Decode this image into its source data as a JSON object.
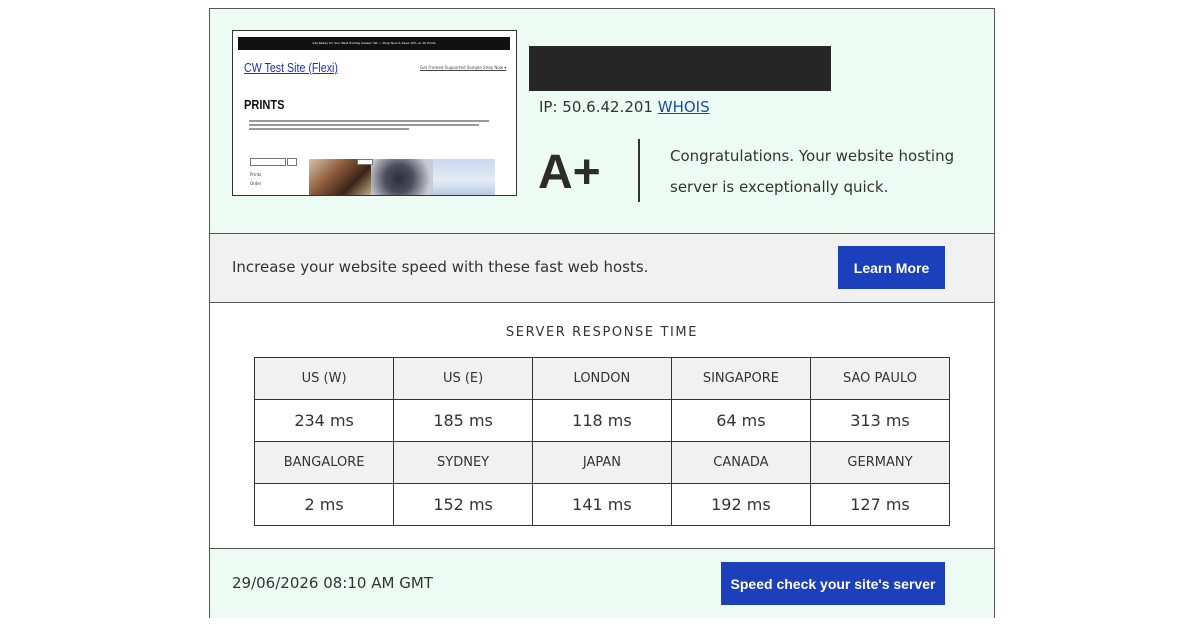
{
  "thumbnail": {
    "topbar_text": "Get Ready for Your Best Holiday Season Yet — Shop Now & Save 10% on All Prints",
    "site_title": "CW Test Site (Flexi)",
    "nav_text": "Get Framed  Supported  Sample  Shop Now  ▾",
    "heading": "PRINTS",
    "menu_item_1": "Prints",
    "menu_item_2": "Order"
  },
  "server": {
    "ip_label": "IP: 50.6.42.201",
    "whois_label": "WHOIS",
    "grade": "A+",
    "message": "Congratulations. Your website hosting server is exceptionally quick."
  },
  "promo": {
    "text": "Increase your website speed with these fast web hosts.",
    "button_label": "Learn More"
  },
  "response_time": {
    "title": "SERVER RESPONSE TIME",
    "rows": [
      {
        "locations": [
          "US (W)",
          "US (E)",
          "LONDON",
          "SINGAPORE",
          "SAO PAULO"
        ],
        "times": [
          "234 ms",
          "185 ms",
          "118 ms",
          "64 ms",
          "313 ms"
        ]
      },
      {
        "locations": [
          "BANGALORE",
          "SYDNEY",
          "JAPAN",
          "CANADA",
          "GERMANY"
        ],
        "times": [
          "2 ms",
          "152 ms",
          "141 ms",
          "192 ms",
          "127 ms"
        ]
      }
    ]
  },
  "footer": {
    "timestamp": "29/06/2026 08:10 AM GMT",
    "button_label": "Speed check your site's server"
  },
  "colors": {
    "accent_blue": "#1c3fbb",
    "panel_mint": "#ecfcf5",
    "panel_gray": "#f1f1f1",
    "redaction": "#262626"
  },
  "icons": {
    "thumbnail_search": "search-icon"
  }
}
